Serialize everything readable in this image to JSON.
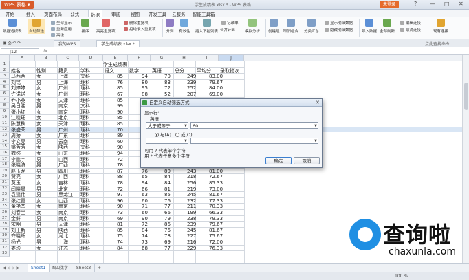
{
  "titlebar": {
    "app_button": "WPS 表格 ▾",
    "doc_title": "学生成绩表.xlsx * - WPS 表格",
    "login": "未登录",
    "controls": [
      "?",
      "—",
      "□",
      "✕"
    ]
  },
  "menu": [
    "开始",
    "插入",
    "页面布局",
    "公式",
    "数据",
    "审阅",
    "视图",
    "开发工具",
    "云服务",
    "智能工具箱"
  ],
  "ribbon": {
    "big": [
      "数据透视表",
      "自动筛选",
      "排序",
      "高亮重复项",
      "分列",
      "有效性",
      "插入下拉列表",
      "合并计算",
      "模拟分析",
      "创建组",
      "取消组合",
      "分类汇总",
      "导入数据",
      "全部刷新",
      "现有连接"
    ],
    "small": [
      "全部显示",
      "重新应用",
      "高级",
      "删除重复项",
      "拒绝录入重复项",
      "记录单",
      "显示明细数据",
      "隐藏明细数据",
      "编辑连接",
      "取消连接"
    ]
  },
  "quick": {
    "my_wps": "我的WPS",
    "file_tab": "学生成绩表.xlsx *",
    "search": "点此查找命令"
  },
  "formula": {
    "cell": "J12",
    "fx": "fx"
  },
  "columns": [
    "A",
    "B",
    "C",
    "D",
    "E",
    "F",
    "G",
    "H",
    "I",
    "J"
  ],
  "table_title": "学生成绩表",
  "headers": [
    "姓名",
    "性别",
    "籍贯",
    "学科",
    "语文",
    "数学",
    "英语",
    "总分",
    "平均分",
    "录取批次"
  ],
  "rows": [
    [
      "马茜茜",
      "女",
      "上海",
      "文科",
      "85",
      "94",
      "70",
      "249",
      "83.00"
    ],
    [
      "刘铭",
      "男",
      "上海",
      "理科",
      "76",
      "80",
      "83",
      "239",
      "79.67"
    ],
    [
      "刘婷婷",
      "女",
      "广州",
      "理科",
      "85",
      "95",
      "72",
      "252",
      "84.00"
    ],
    [
      "许诺诺",
      "女",
      "广州",
      "理科",
      "67",
      "88",
      "52",
      "207",
      "69.00"
    ],
    [
      "乔小英",
      "女",
      "天津",
      "理科",
      "85",
      "",
      "",
      "",
      ""
    ],
    [
      "吴日胜",
      "男",
      "南京",
      "文科",
      "99",
      "",
      "",
      "",
      ""
    ],
    [
      "张小红",
      "女",
      "南京",
      "理科",
      "90",
      "",
      "",
      "",
      ""
    ],
    [
      "江晓珏",
      "女",
      "北京",
      "理科",
      "85",
      "",
      "",
      "",
      ""
    ],
    [
      "陈慧秋",
      "女",
      "天津",
      "理科",
      "85",
      "",
      "",
      "",
      ""
    ],
    [
      "张盛荣",
      "男",
      "广州",
      "理科",
      "70",
      "",
      "",
      "",
      ""
    ],
    [
      "周娇",
      "女",
      "广东",
      "理科",
      "89",
      "",
      "",
      "",
      ""
    ],
    [
      "李文亮",
      "男",
      "云南",
      "理科",
      "60",
      "",
      "",
      "",
      ""
    ],
    [
      "姚芳芳",
      "女",
      "陕西",
      "文科",
      "90",
      "",
      "",
      "",
      ""
    ],
    [
      "魏然",
      "女",
      "山东",
      "理科",
      "94",
      "",
      "",
      "",
      ""
    ],
    [
      "李鹏宇",
      "男",
      "山西",
      "理科",
      "72",
      "",
      "",
      "",
      ""
    ],
    [
      "张晓波",
      "男",
      "广西",
      "理科",
      "78",
      "",
      "",
      "214",
      "71.33"
    ],
    [
      "赵玉龙",
      "男",
      "四川",
      "理科",
      "87",
      "76",
      "80",
      "243",
      "81.00"
    ],
    [
      "贺亮",
      "女",
      "广西",
      "理科",
      "88",
      "65",
      "84",
      "218",
      "72.67"
    ],
    [
      "莫玉",
      "女",
      "吉林",
      "理科",
      "78",
      "94",
      "84",
      "256",
      "85.33"
    ],
    [
      "闫晓晨",
      "男",
      "北京",
      "理科",
      "72",
      "66",
      "81",
      "219",
      "73.00"
    ],
    [
      "袁建伟",
      "男",
      "黑龙江",
      "理科",
      "97",
      "63",
      "85",
      "245",
      "81.67"
    ],
    [
      "张红霞",
      "女",
      "山西",
      "理科",
      "96",
      "60",
      "76",
      "232",
      "77.33"
    ],
    [
      "董艳杰",
      "女",
      "南京",
      "理科",
      "90",
      "71",
      "77",
      "211",
      "70.33"
    ],
    [
      "刘春兰",
      "女",
      "南京",
      "理科",
      "73",
      "60",
      "66",
      "199",
      "66.33"
    ],
    [
      "金鲜",
      "男",
      "南京",
      "理科",
      "69",
      "90",
      "79",
      "238",
      "79.33"
    ],
    [
      "宋明",
      "男",
      "天津",
      "理科",
      "81",
      "72",
      "86",
      "239",
      "79.67"
    ],
    [
      "刘正新",
      "男",
      "陕西",
      "理科",
      "85",
      "84",
      "76",
      "245",
      "81.67"
    ],
    [
      "齐晓辉",
      "女",
      "河北",
      "理科",
      "75",
      "74",
      "78",
      "227",
      "75.67"
    ],
    [
      "杨光",
      "男",
      "上海",
      "理科",
      "74",
      "73",
      "69",
      "216",
      "72.00"
    ],
    [
      "姜珍",
      "女",
      "江苏",
      "理科",
      "84",
      "68",
      "77",
      "229",
      "76.33"
    ]
  ],
  "dialog": {
    "title": "自定义自动筛选方式",
    "close": "✕",
    "show_rows": "显示行:",
    "field": "英语",
    "operator": "大于或等于",
    "value": "60",
    "and_label": "与(A)",
    "or_label": "或(O)",
    "hint1": "可用 ? 代表单个字符",
    "hint2": "用 * 代表任意多个字符",
    "ok": "确定",
    "cancel": "取消"
  },
  "sheets": [
    "Sheet1",
    "图四数字",
    "Sheet3"
  ],
  "add_sheet": "+",
  "status": {
    "zoom": "100 %"
  },
  "watermark": {
    "brand": "查询啦",
    "domain": "chaxunla.com"
  }
}
